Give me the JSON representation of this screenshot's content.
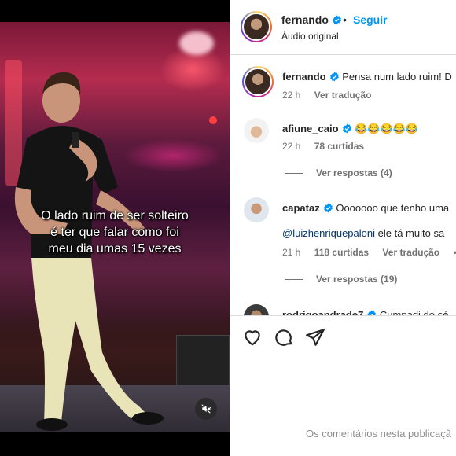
{
  "video": {
    "caption_lines": [
      "O lado ruim de ser solteiro",
      "é ter que falar como foi",
      "meu dia umas 15 vezes"
    ]
  },
  "header": {
    "username": "fernando",
    "separator": "•",
    "follow_label": "Seguir",
    "audio_label": "Áudio original"
  },
  "comments": [
    {
      "username": "fernando",
      "verified": true,
      "text": "Pensa num lado ruim! D",
      "time": "22 h",
      "translate": "Ver tradução"
    },
    {
      "username": "afiune_caio",
      "verified": true,
      "text": "😂😂😂😂😂",
      "time": "22 h",
      "likes": "78 curtidas",
      "replies": "Ver respostas (4)"
    },
    {
      "username": "capataz",
      "verified": true,
      "text": "Ooooooo que tenho uma",
      "mention": "@luizhenriquepaloni",
      "mention_rest": "ele tá muito sa",
      "time": "21 h",
      "likes": "118 curtidas",
      "translate": "Ver tradução",
      "more": "•••",
      "replies": "Ver respostas (19)"
    },
    {
      "username": "rodrigoandrade7",
      "verified": true,
      "text": "Cumpadi do cé"
    }
  ],
  "comment_box": {
    "placeholder": "Os comentários nesta publicaçã"
  },
  "icons": [
    "heart-icon",
    "comment-icon",
    "share-icon",
    "muted-speaker-icon",
    "verified-icon"
  ],
  "colors": {
    "accent": "#0095f6",
    "verified": "#0095f6",
    "text": "#262626",
    "secondary": "#737373"
  }
}
